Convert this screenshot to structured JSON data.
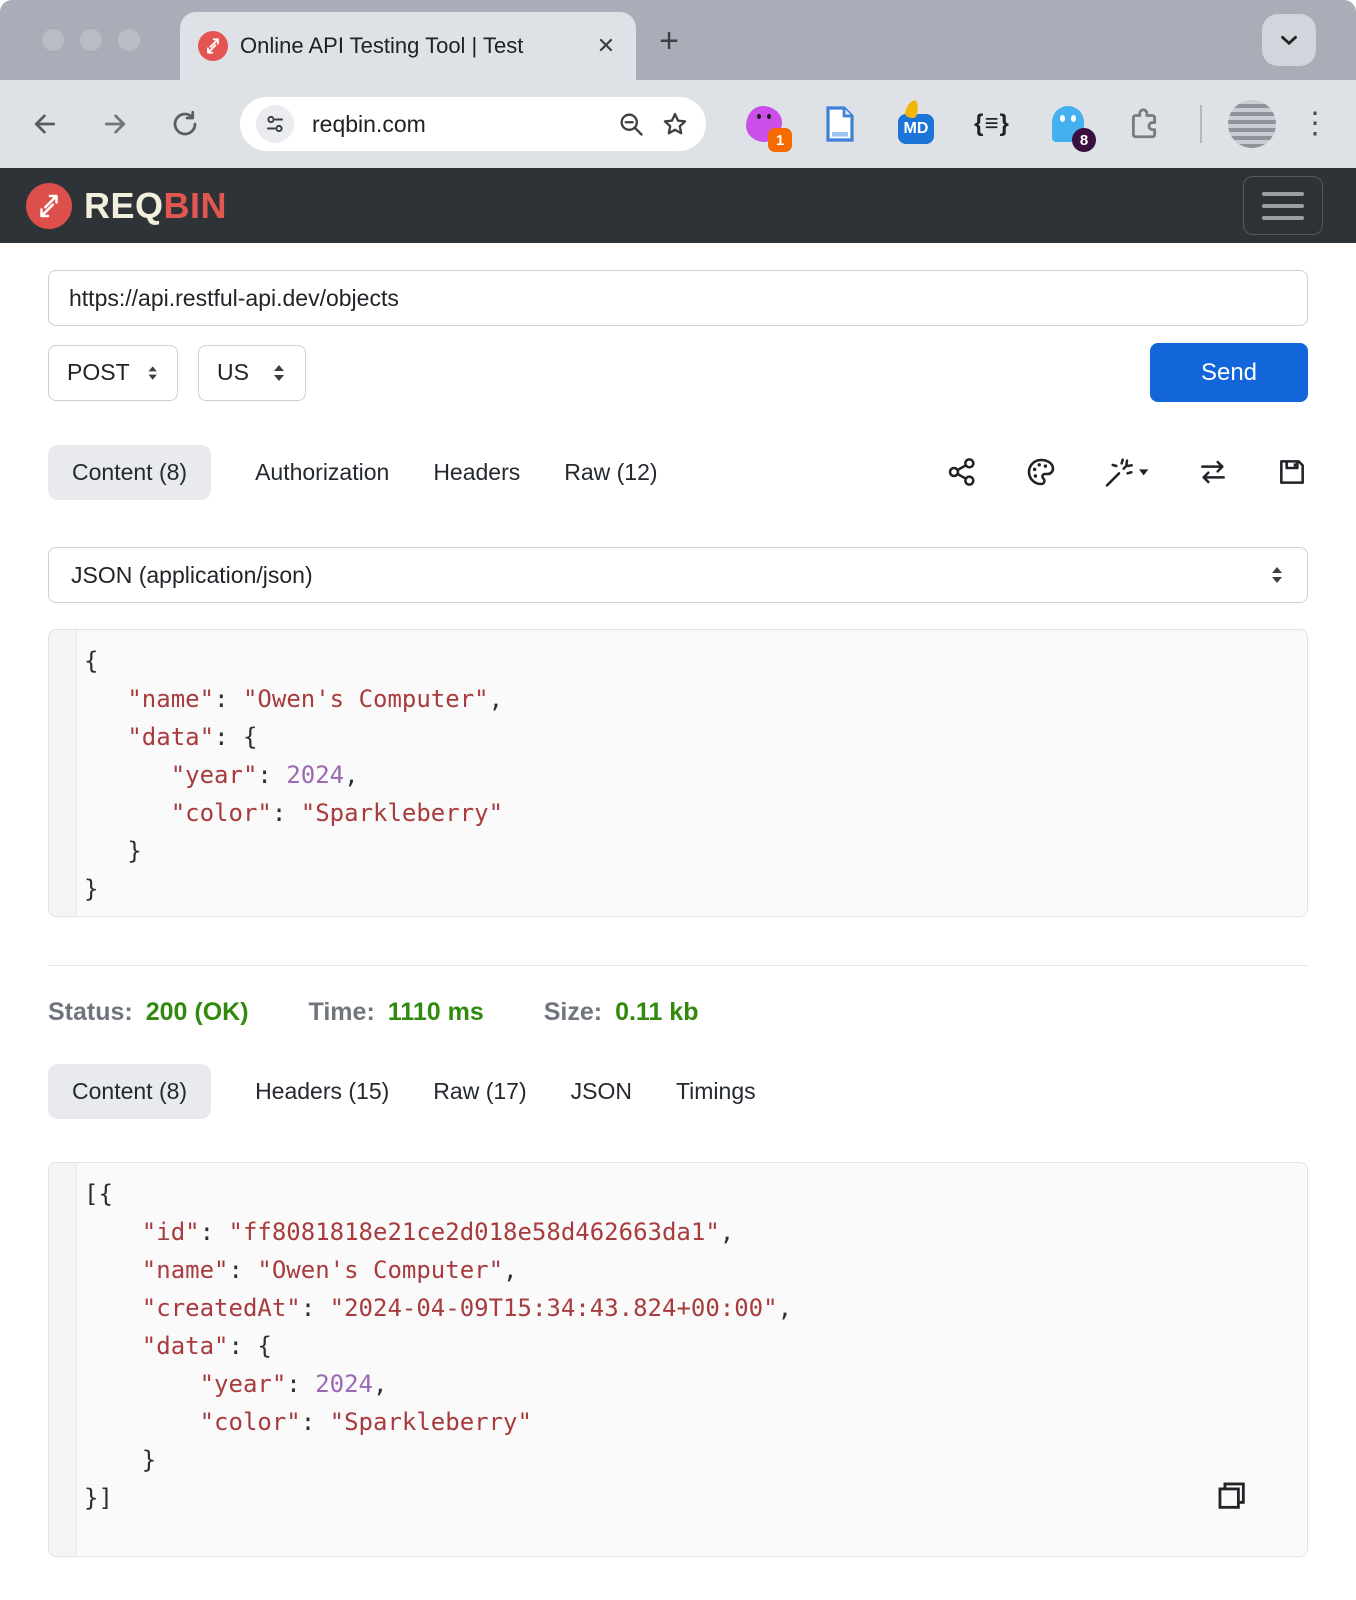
{
  "browser": {
    "tab": {
      "title": "Online API Testing Tool | Test",
      "close_icon": "✕"
    },
    "new_tab_icon": "+",
    "address": {
      "url": "reqbin.com"
    },
    "extensions": {
      "blob_badge": "1",
      "md_label": "MD",
      "braces_label": "{≡}",
      "ghost_badge": "8"
    },
    "menu_icon": "⋮"
  },
  "site_header": {
    "brand_req": "REQ",
    "brand_bin": "BIN"
  },
  "request": {
    "url": "https://api.restful-api.dev/objects",
    "method": "POST",
    "locale": "US",
    "send_label": "Send",
    "tabs": [
      "Content (8)",
      "Authorization",
      "Headers",
      "Raw (12)"
    ],
    "content_type": "JSON (application/json)",
    "body_lines": [
      [
        {
          "t": "{",
          "c": "p"
        }
      ],
      [
        {
          "t": "   ",
          "c": "p"
        },
        {
          "t": "\"name\"",
          "c": "k"
        },
        {
          "t": ": ",
          "c": "p"
        },
        {
          "t": "\"Owen's Computer\"",
          "c": "k"
        },
        {
          "t": ",",
          "c": "p"
        }
      ],
      [
        {
          "t": "   ",
          "c": "p"
        },
        {
          "t": "\"data\"",
          "c": "k"
        },
        {
          "t": ": {",
          "c": "p"
        }
      ],
      [
        {
          "t": "      ",
          "c": "p"
        },
        {
          "t": "\"year\"",
          "c": "k"
        },
        {
          "t": ": ",
          "c": "p"
        },
        {
          "t": "2024",
          "c": "n"
        },
        {
          "t": ",",
          "c": "p"
        }
      ],
      [
        {
          "t": "      ",
          "c": "p"
        },
        {
          "t": "\"color\"",
          "c": "k"
        },
        {
          "t": ": ",
          "c": "p"
        },
        {
          "t": "\"Sparkleberry\"",
          "c": "k"
        }
      ],
      [
        {
          "t": "   }",
          "c": "p"
        }
      ],
      [
        {
          "t": "}",
          "c": "p"
        }
      ]
    ]
  },
  "response": {
    "status": {
      "label": "Status:",
      "value": "200 (OK)"
    },
    "time": {
      "label": "Time:",
      "value": "1110 ms"
    },
    "size": {
      "label": "Size:",
      "value": "0.11 kb"
    },
    "tabs": [
      "Content (8)",
      "Headers (15)",
      "Raw (17)",
      "JSON",
      "Timings"
    ],
    "body_lines": [
      [
        {
          "t": "[{",
          "c": "p"
        }
      ],
      [
        {
          "t": "    ",
          "c": "p"
        },
        {
          "t": "\"id\"",
          "c": "k"
        },
        {
          "t": ": ",
          "c": "p"
        },
        {
          "t": "\"ff8081818e21ce2d018e58d462663da1\"",
          "c": "k"
        },
        {
          "t": ",",
          "c": "p"
        }
      ],
      [
        {
          "t": "    ",
          "c": "p"
        },
        {
          "t": "\"name\"",
          "c": "k"
        },
        {
          "t": ": ",
          "c": "p"
        },
        {
          "t": "\"Owen's Computer\"",
          "c": "k"
        },
        {
          "t": ",",
          "c": "p"
        }
      ],
      [
        {
          "t": "    ",
          "c": "p"
        },
        {
          "t": "\"createdAt\"",
          "c": "k"
        },
        {
          "t": ": ",
          "c": "p"
        },
        {
          "t": "\"2024-04-09T15:34:43.824+00:00\"",
          "c": "k"
        },
        {
          "t": ",",
          "c": "p"
        }
      ],
      [
        {
          "t": "    ",
          "c": "p"
        },
        {
          "t": "\"data\"",
          "c": "k"
        },
        {
          "t": ": {",
          "c": "p"
        }
      ],
      [
        {
          "t": "        ",
          "c": "p"
        },
        {
          "t": "\"year\"",
          "c": "k"
        },
        {
          "t": ": ",
          "c": "p"
        },
        {
          "t": "2024",
          "c": "n"
        },
        {
          "t": ",",
          "c": "p"
        }
      ],
      [
        {
          "t": "        ",
          "c": "p"
        },
        {
          "t": "\"color\"",
          "c": "k"
        },
        {
          "t": ": ",
          "c": "p"
        },
        {
          "t": "\"Sparkleberry\"",
          "c": "k"
        }
      ],
      [
        {
          "t": "    }",
          "c": "p"
        }
      ],
      [
        {
          "t": "}]",
          "c": "p"
        }
      ]
    ]
  },
  "colors": {
    "accent_blue": "#1266d9",
    "brand_red": "#e2574f",
    "status_green": "#318a0e",
    "code_key_red": "#a83b3d",
    "code_number_purple": "#9a68b5",
    "dark_header": "#2e3338"
  }
}
